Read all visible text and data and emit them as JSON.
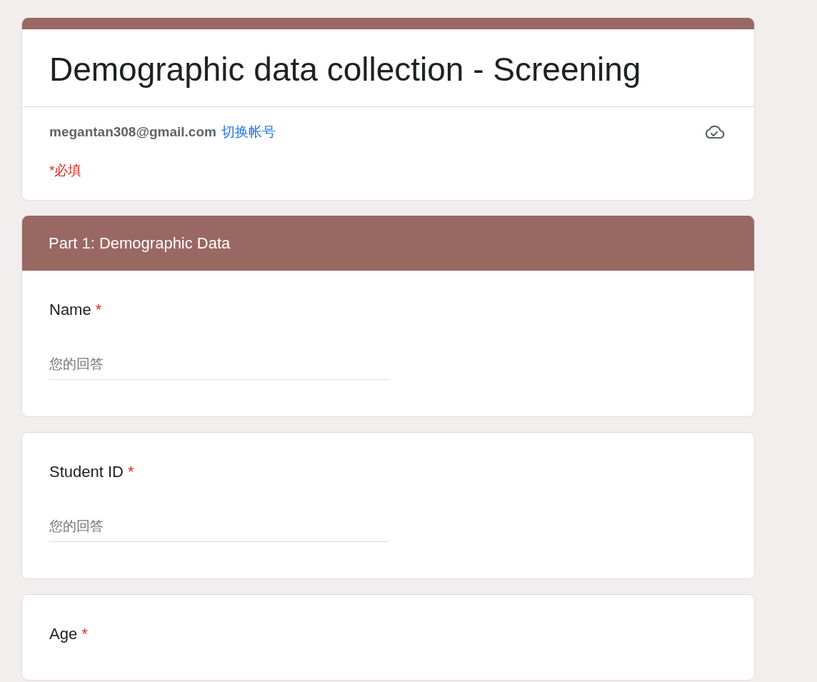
{
  "form": {
    "title": "Demographic data collection - Screening",
    "account": {
      "email": "megantan308@gmail.com",
      "switch_link": "切换帐号"
    },
    "required_note": "*必填"
  },
  "sections": [
    {
      "title": "Part 1: Demographic Data",
      "questions": [
        {
          "label": "Name",
          "required_mark": "*",
          "placeholder": "您的回答"
        },
        {
          "label": "Student ID",
          "required_mark": "*",
          "placeholder": "您的回答"
        },
        {
          "label": "Age",
          "required_mark": "*"
        }
      ]
    }
  ]
}
